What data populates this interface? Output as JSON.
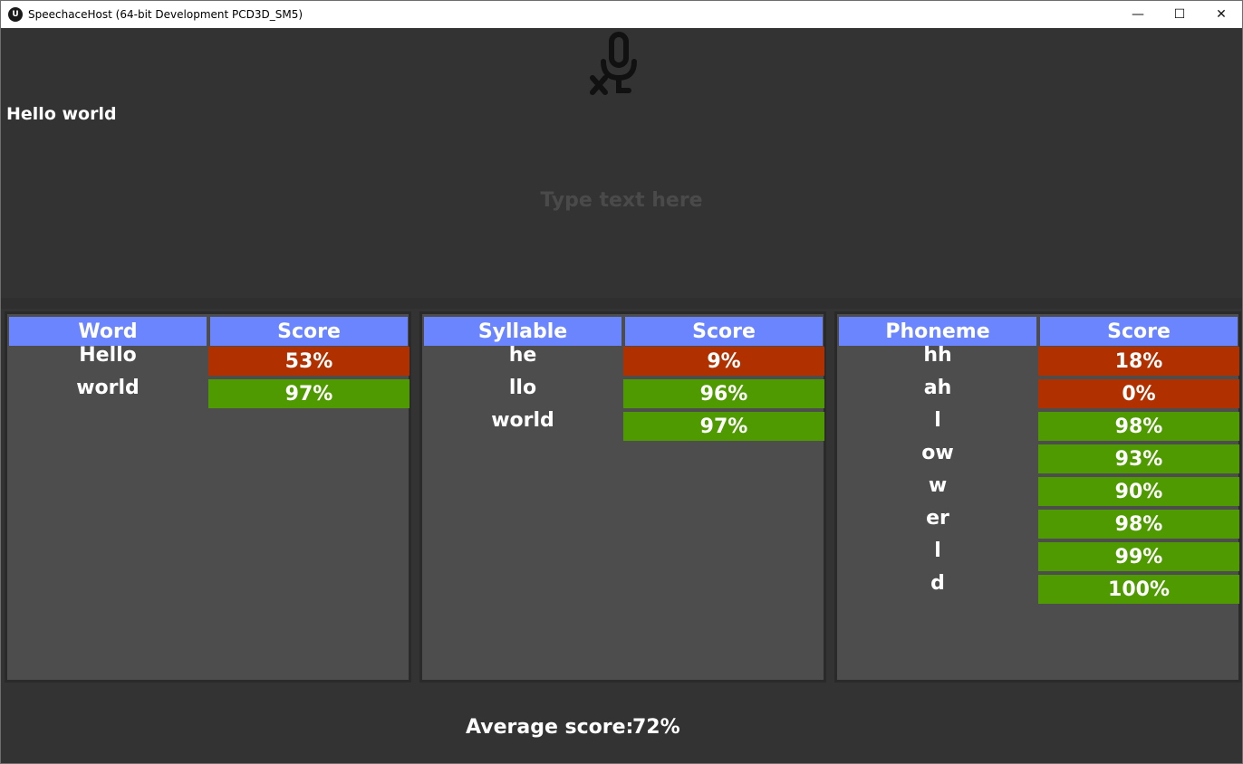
{
  "window": {
    "title": "SpeechaceHost (64-bit Development PCD3D_SM5)",
    "minimize": "—",
    "maximize": "☐",
    "close": "✕"
  },
  "top": {
    "heading": "Hello world",
    "input_placeholder": "Type text here",
    "input_value": "",
    "mic_icon": "microphone-muted-icon"
  },
  "colors": {
    "header_bg": "#6b85ff",
    "score_low": "#b03000",
    "score_high": "#4f9a00",
    "panel_bg": "#4d4d4d",
    "app_bg": "#333333"
  },
  "word_panel": {
    "label_header": "Word",
    "score_header": "Score",
    "rows": [
      {
        "label": "Hello",
        "score": "53%",
        "status": "low"
      },
      {
        "label": "world",
        "score": "97%",
        "status": "high"
      }
    ]
  },
  "syllable_panel": {
    "label_header": "Syllable",
    "score_header": "Score",
    "rows": [
      {
        "label": "he",
        "score": "9%",
        "status": "low"
      },
      {
        "label": "llo",
        "score": "96%",
        "status": "high"
      },
      {
        "label": "world",
        "score": "97%",
        "status": "high"
      }
    ]
  },
  "phoneme_panel": {
    "label_header": "Phoneme",
    "score_header": "Score",
    "rows": [
      {
        "label": "hh",
        "score": "18%",
        "status": "low"
      },
      {
        "label": "ah",
        "score": "0%",
        "status": "low"
      },
      {
        "label": "l",
        "score": "98%",
        "status": "high"
      },
      {
        "label": "ow",
        "score": "93%",
        "status": "high"
      },
      {
        "label": "w",
        "score": "90%",
        "status": "high"
      },
      {
        "label": "er",
        "score": "98%",
        "status": "high"
      },
      {
        "label": "l",
        "score": "99%",
        "status": "high"
      },
      {
        "label": "d",
        "score": "100%",
        "status": "high"
      }
    ]
  },
  "footer": {
    "average_label": "Average score:",
    "average_value": "72%"
  }
}
